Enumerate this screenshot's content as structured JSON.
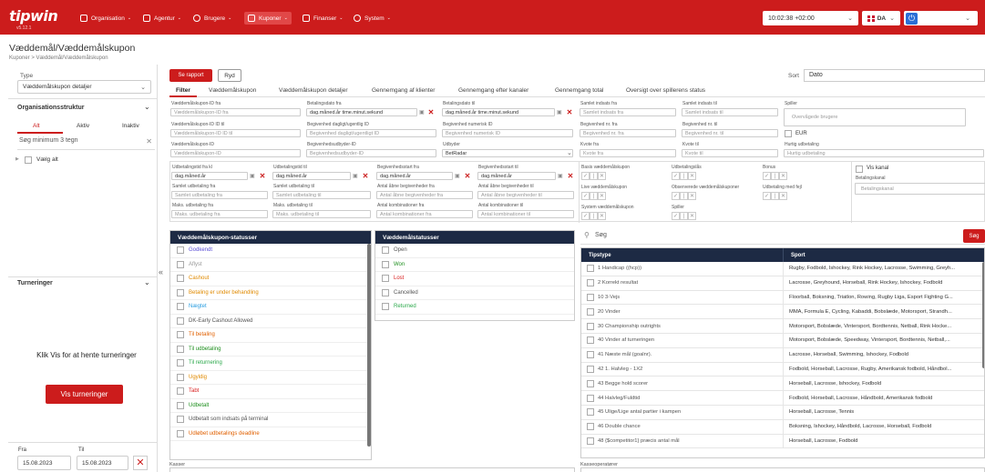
{
  "header": {
    "logo": "tipwin",
    "version": "v5.12.1",
    "menu": [
      "Organisation",
      "Agentur",
      "Brugere",
      "Kuponer",
      "Finanser",
      "System"
    ],
    "time": "10:02:38 +02:00",
    "lang": "DA"
  },
  "page": {
    "title": "Væddemål/Væddemålskupon",
    "breadcrumb": "Kuponer  >  Væddemål/Væddemålskupon"
  },
  "left": {
    "type_label": "Type",
    "type_value": "Væddemålskupon detaljer",
    "org_title": "Organisationsstruktur",
    "org_tabs": [
      "Alt",
      "Aktiv",
      "Inaktiv"
    ],
    "search_placeholder": "Søg minimum 3 tegn",
    "select_all": "Vælg alt",
    "tourn_title": "Turneringer",
    "tourn_text": "Klik Vis for at hente turneringer",
    "tourn_button": "Vis turneringer",
    "from_label": "Fra",
    "to_label": "Til",
    "from_value": "15.08.2023",
    "to_value": "15.08.2023"
  },
  "toolbar": {
    "report": "Se rapport",
    "clear": "Ryd",
    "sort_label": "Sort",
    "sort_value": "Dato"
  },
  "tabs": [
    "Filter",
    "Væddemålskupon",
    "Væddemålskupon detaljer",
    "Gennemgang af klienter",
    "Gennemgang efter kanaler",
    "Gennemgang total",
    "Oversigt over spillerens status"
  ],
  "filters": {
    "r1": [
      {
        "l": "Væddemålskupon-ID fra",
        "p": "Væddemålskupon-ID fra"
      },
      {
        "l": "Betalingsdato fra",
        "p": "dag.måned.år time.minut.sekund"
      },
      {
        "l": "Betalingsdato til",
        "p": "dag.måned.år time.minut.sekund"
      },
      {
        "l": "Samlet indsats fra",
        "p": "Samlet indsats fra"
      },
      {
        "l": "Samlet indsats til",
        "p": "Samlet indsats til"
      },
      {
        "l": "Spiller",
        "p": "Overvågede brugere"
      }
    ],
    "r2": [
      {
        "l": "Væddemålskupon-ID ID til",
        "p": "Væddemålskupon-ID ID til"
      },
      {
        "l": "Begivenhed dagligt/ugentlig ID",
        "p": "Begivenhed dagligt/ugentligt ID"
      },
      {
        "l": "Begivenhed numerisk ID",
        "p": "Begivenhed numerisk ID"
      },
      {
        "l": "Begivenhed nr. fra",
        "p": "Begivenhed nr. fra"
      },
      {
        "l": "Begivenhed nr. til",
        "p": "Begivenhed nr. til"
      },
      {
        "l": "",
        "p": "EUR"
      }
    ],
    "r3": [
      {
        "l": "Væddemålskupon-ID",
        "p": "Væddemålskupon-ID"
      },
      {
        "l": "Begivenhedsudbyder-ID",
        "p": "Begivenhedsudbyder-ID"
      },
      {
        "l": "Udbyder",
        "p": "BetRadar"
      },
      {
        "l": "Kvote fra",
        "p": "Kvote fra"
      },
      {
        "l": "Kvote til",
        "p": "Kvote til"
      },
      {
        "l": "Hurtig udbetaling",
        "p": "Hurtig udbetaling"
      }
    ],
    "r4": [
      {
        "l": "Udbetalingstid fra kl",
        "p": "dag.måned.år"
      },
      {
        "l": "Udbetalingstid til",
        "p": "dag.måned.år"
      },
      {
        "l": "Begivenhedsstart fra",
        "p": "dag.måned.år"
      },
      {
        "l": "Begivenhedsstart til",
        "p": "dag.måned.år"
      }
    ],
    "r5": [
      {
        "l": "Samlet udbetaling fra",
        "p": "Samlet udbetaling fra"
      },
      {
        "l": "Samlet udbetaling til",
        "p": "Samlet udbetaling til"
      },
      {
        "l": "Antal åbne begivenheder fra",
        "p": "Antal åbne begivenheder fra"
      },
      {
        "l": "Antal åbne begivenheder til",
        "p": "Antal åbne begivenheder til"
      }
    ],
    "r6": [
      {
        "l": "Maks. udbetaling fra",
        "p": "Maks. udbetaling fra"
      },
      {
        "l": "Maks. udbetaling til",
        "p": "Maks. udbetaling til"
      },
      {
        "l": "Antal kombinationer fra",
        "p": "Antal kombinationer fra"
      },
      {
        "l": "Antal kombinationer til",
        "p": "Antal kombinationer til"
      }
    ],
    "flags": [
      "Basis væddemålskupon",
      "Udbetalingslås",
      "Bonus",
      "Live væddemålskupon",
      "Observerede væddemålskuponer",
      "Udbetaling med fejl",
      "System væddemålskupon",
      "Spiller"
    ],
    "vis_kanal": "Vis kanal",
    "betalingskanal_label": "Betalingskanal",
    "betalingskanal_placeholder": "Betalingskanal"
  },
  "coupon_status": {
    "title": "Væddemålskupon-statusser",
    "items": [
      {
        "t": "Godkendt",
        "c": "#5b4fd6"
      },
      {
        "t": "Aflyst",
        "c": "#999999"
      },
      {
        "t": "Cashout",
        "c": "#e08a00"
      },
      {
        "t": "Betaling er under behandling",
        "c": "#e08a00"
      },
      {
        "t": "Nægtet",
        "c": "#2a9de0"
      },
      {
        "t": "DK-Early Cashout Allowed",
        "c": "#555555"
      },
      {
        "t": "Til betaling",
        "c": "#e06000"
      },
      {
        "t": "Til udbetaling",
        "c": "#1f8f1f"
      },
      {
        "t": "Til returnering",
        "c": "#2aa84a"
      },
      {
        "t": "Ugyldig",
        "c": "#e08a00"
      },
      {
        "t": "Tabt",
        "c": "#d92020"
      },
      {
        "t": "Udbetalt",
        "c": "#1f8f1f"
      },
      {
        "t": "Udbetalt som indsats på terminal",
        "c": "#555555"
      },
      {
        "t": "Udløbet udbetalings deadline",
        "c": "#e06000"
      }
    ]
  },
  "bet_status": {
    "title": "Væddemålstatusser",
    "items": [
      {
        "t": "Open",
        "c": "#555555"
      },
      {
        "t": "Won",
        "c": "#1f8f1f"
      },
      {
        "t": "Lost",
        "c": "#d92020"
      },
      {
        "t": "Cancelled",
        "c": "#555555"
      },
      {
        "t": "Returned",
        "c": "#2aa84a"
      }
    ]
  },
  "tip": {
    "search_placeholder": "Søg",
    "search_button": "Søg",
    "col1": "Tipstype",
    "col2": "Sport",
    "rows": [
      [
        "1 Handicap ((hcp))",
        "Rugby, Fodbold, Ishockey, Rink Hockey, Lacrosse, Swimming, Greyh..."
      ],
      [
        "2 Korrekt resultat",
        "Lacrosse, Greyhound, Horseball, Rink Hockey, Ishockey, Fodbold"
      ],
      [
        "10 3-Vejs",
        "Floorball, Boksning, Triatlon, Rowing, Rugby Liga, Esport Fighting G..."
      ],
      [
        "20 Vinder",
        "MMA, Formula E, Cycling, Kabaddi, Bobslæde, Motorsport, Strandh..."
      ],
      [
        "30 Championship outrights",
        "Motorsport, Bobslæde, Vintersport, Bordtennis, Netball, Rink Hocke..."
      ],
      [
        "40 Vinder af turneringen",
        "Motorsport, Bobslæde, Speedway, Vintersport, Bordtennis, Netball,..."
      ],
      [
        "41 Næste mål (goalnr).",
        "Lacrosse, Horseball, Swimming, Ishockey, Fodbold"
      ],
      [
        "42 1. Halvleg - 1X2",
        "Fodbold, Horseball, Lacrosse, Rugby, Amerikansk fodbold, Håndbol..."
      ],
      [
        "43 Begge hold scorer",
        "Horseball, Lacrosse, Ishockey, Fodbold"
      ],
      [
        "44 Halvleg/Fuldtid",
        "Fodbold, Horseball, Lacrosse, Håndbold, Amerikansk fodbold"
      ],
      [
        "45 Ulige/Lige antal partier i kampen",
        "Horseball, Lacrosse, Tennis"
      ],
      [
        "46 Double chance",
        "Boksning, Ishockey, Håndbold, Lacrosse, Horseball, Fodbold"
      ],
      [
        "48 {$competitor1} præcis antal mål",
        "Horseball, Lacrosse, Fodbold"
      ]
    ]
  },
  "bottom": {
    "kasser": "Kasser",
    "kasseoperatorer": "Kasseoperatører"
  }
}
